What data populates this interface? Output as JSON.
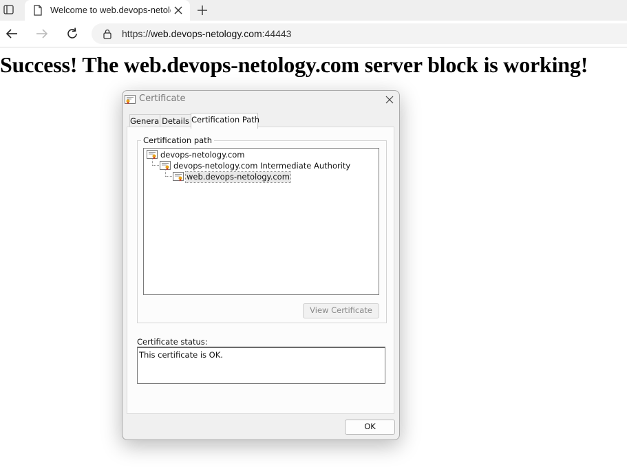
{
  "browser": {
    "tab_title": "Welcome to web.devops-netolog",
    "url_scheme": "https://",
    "url_host": "web.devops-netology.com",
    "url_port": ":44443"
  },
  "page": {
    "headline": "Success!  The web.devops-netology.com server block is working!"
  },
  "dialog": {
    "title": "Certificate",
    "tabs": [
      "General",
      "Details",
      "Certification Path"
    ],
    "active_tab": "Certification Path",
    "path_group_label": "Certification path",
    "path": [
      {
        "label": "devops-netology.com"
      },
      {
        "label": "devops-netology.com Intermediate Authority"
      },
      {
        "label": "web.devops-netology.com",
        "selected": true
      }
    ],
    "view_certificate_label": "View Certificate",
    "status_label": "Certificate status:",
    "status_text": "This certificate is OK.",
    "ok_label": "OK"
  },
  "colors": {
    "cert_ribbon": "#e8a21a",
    "cert_seal": "#c9302c"
  },
  "icons": {
    "tab_actions": "tab-actions-icon",
    "page": "page-icon",
    "close": "close-icon",
    "new_tab": "plus-icon",
    "back": "back-arrow-icon",
    "forward": "forward-arrow-icon",
    "refresh": "refresh-icon",
    "lock": "lock-icon",
    "certificate": "certificate-icon"
  }
}
